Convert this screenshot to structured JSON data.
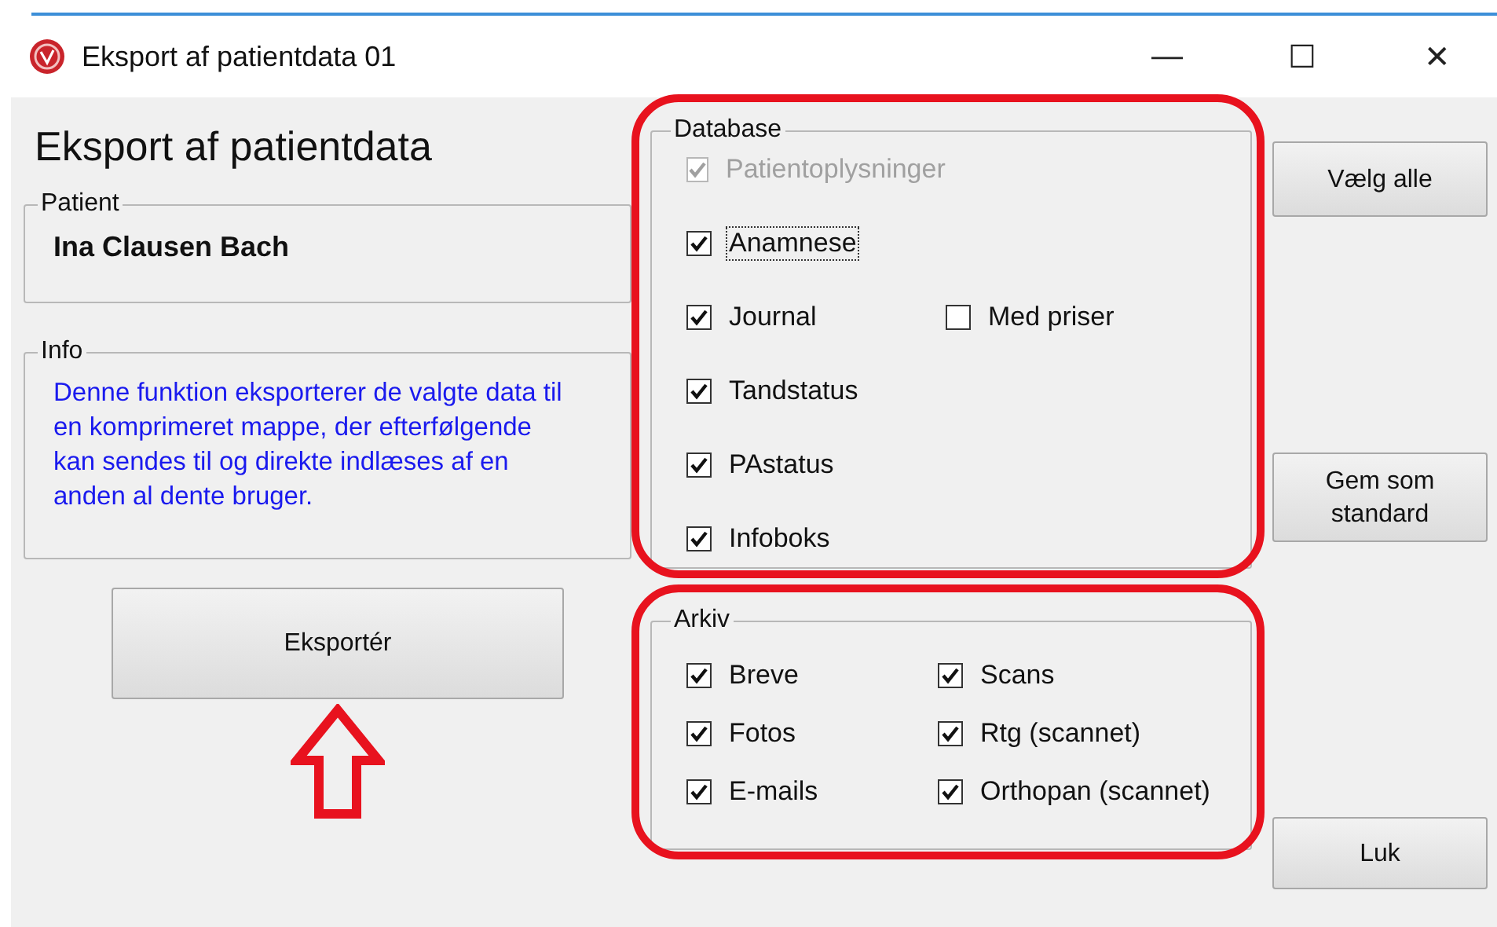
{
  "window": {
    "title": "Eksport af patientdata 01",
    "controls": [
      "—",
      "☐",
      "✕"
    ]
  },
  "heading": "Eksport af patientdata",
  "patient": {
    "legend": "Patient",
    "name": "Ina Clausen Bach"
  },
  "info": {
    "legend": "Info",
    "text": "Denne funktion eksporterer de valgte data til en komprimeret mappe, der efterfølgende kan sendes til og direkte indlæses af en anden al dente bruger."
  },
  "export_button": "Eksportér",
  "database": {
    "legend": "Database",
    "items": [
      {
        "label": "Patientoplysninger",
        "checked": true,
        "disabled": true,
        "focused": false
      },
      {
        "label": "Anamnese",
        "checked": true,
        "disabled": false,
        "focused": true
      },
      {
        "label": "Journal",
        "checked": true,
        "disabled": false,
        "focused": false,
        "extra": {
          "label": "Med priser",
          "checked": false
        }
      },
      {
        "label": "Tandstatus",
        "checked": true,
        "disabled": false,
        "focused": false
      },
      {
        "label": "PAstatus",
        "checked": true,
        "disabled": false,
        "focused": false
      },
      {
        "label": "Infoboks",
        "checked": true,
        "disabled": false,
        "focused": false
      }
    ]
  },
  "archive": {
    "legend": "Arkiv",
    "items": [
      {
        "label": "Breve",
        "checked": true
      },
      {
        "label": "Scans",
        "checked": true
      },
      {
        "label": "Fotos",
        "checked": true
      },
      {
        "label": "Rtg (scannet)",
        "checked": true
      },
      {
        "label": "E-mails",
        "checked": true
      },
      {
        "label": "Orthopan (scannet)",
        "checked": true
      }
    ]
  },
  "buttons": [
    "Vælg alle",
    "Gem som standard",
    "Luk"
  ]
}
